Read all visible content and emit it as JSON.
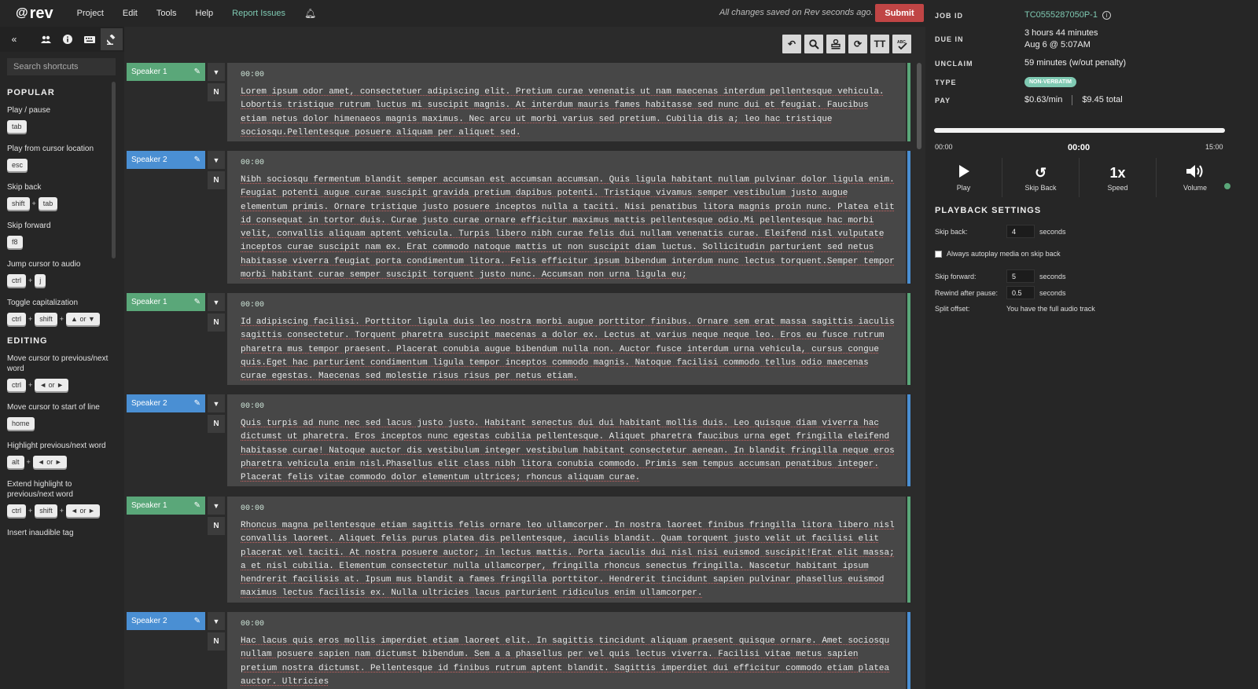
{
  "app": {
    "logo": "rev",
    "menu": [
      "Project",
      "Edit",
      "Tools",
      "Help",
      "Report Issues"
    ],
    "saved_status": "All changes saved on Rev seconds ago.",
    "submit_label": "Submit"
  },
  "sidebar": {
    "tabs": [
      "collapse-icon",
      "people-icon",
      "info-icon",
      "keyboard-icon",
      "gavel-icon"
    ],
    "search_placeholder": "Search shortcuts",
    "sections": [
      {
        "title": "POPULAR",
        "items": [
          {
            "label": "Play / pause",
            "keys": [
              "tab"
            ]
          },
          {
            "label": "Play from cursor location",
            "keys": [
              "esc"
            ]
          },
          {
            "label": "Skip back",
            "keys": [
              "shift",
              "tab"
            ]
          },
          {
            "label": "Skip forward",
            "keys": [
              "f8"
            ]
          },
          {
            "label": "Jump cursor to audio",
            "keys": [
              "ctrl",
              "j"
            ]
          },
          {
            "label": "Toggle capitalization",
            "keys": [
              "ctrl",
              "shift",
              "▲ or ▼"
            ]
          }
        ]
      },
      {
        "title": "EDITING",
        "items": [
          {
            "label": "Move cursor to previous/next word",
            "keys": [
              "ctrl",
              "◄ or ►"
            ]
          },
          {
            "label": "Move cursor to start of line",
            "keys": [
              "home"
            ]
          },
          {
            "label": "Highlight previous/next word",
            "keys": [
              "alt",
              "◄ or ►"
            ]
          },
          {
            "label": "Extend highlight to previous/next word",
            "keys": [
              "ctrl",
              "shift",
              "◄ or ►"
            ]
          },
          {
            "label": "Insert inaudible tag",
            "keys": []
          }
        ]
      }
    ]
  },
  "toolbar": {
    "tools": [
      "undo-icon",
      "search-icon",
      "stamp-icon",
      "rotate-icon",
      "text-size-icon",
      "spellcheck-icon"
    ]
  },
  "segments": [
    {
      "speaker": "Speaker 1",
      "color_class": "s1",
      "timestamp": "00:00",
      "text": "Lorem ipsum odor amet, consectetuer adipiscing elit. Pretium curae venenatis ut nam maecenas interdum pellentesque vehicula. Lobortis tristique rutrum luctus mi suscipit magnis. At interdum mauris fames habitasse sed nunc dui et feugiat. Faucibus etiam netus dolor himenaeos magnis maximus. Nec arcu ut morbi varius sed pretium. Cubilia dis a; leo hac tristique sociosqu.Pellentesque posuere aliquam per aliquet sed."
    },
    {
      "speaker": "Speaker 2",
      "color_class": "s2",
      "timestamp": "00:00",
      "text": "Nibh sociosqu fermentum blandit semper accumsan est accumsan accumsan. Quis ligula habitant nullam pulvinar dolor ligula enim. Feugiat potenti augue curae suscipit gravida pretium dapibus potenti. Tristique vivamus semper vestibulum justo augue elementum primis. Ornare tristique justo posuere inceptos nulla a taciti. Nisi penatibus litora magnis proin nunc. Platea elit id consequat in tortor duis. Curae justo curae ornare efficitur maximus mattis pellentesque odio.Mi pellentesque hac morbi velit, convallis aliquam aptent vehicula. Turpis libero nibh curae felis dui nullam venenatis curae. Eleifend nisl vulputate inceptos curae suscipit nam ex. Erat commodo natoque mattis ut non suscipit diam luctus. Sollicitudin parturient sed netus habitasse viverra feugiat porta condimentum litora. Felis efficitur ipsum bibendum interdum nunc lectus torquent.Semper tempor morbi habitant curae semper suscipit torquent justo nunc. Accumsan non urna ligula eu;"
    },
    {
      "speaker": "Speaker 1",
      "color_class": "s1",
      "timestamp": "00:00",
      "text": "Id adipiscing facilisi. Porttitor ligula duis leo nostra morbi augue porttitor finibus. Ornare sem erat massa sagittis iaculis sagittis consectetur. Torquent pharetra suscipit maecenas a dolor ex. Lectus at varius neque neque leo. Eros eu fusce rutrum pharetra mus tempor praesent. Placerat conubia augue bibendum nulla non. Auctor fusce interdum urna vehicula, cursus congue quis.Eget hac parturient condimentum ligula tempor inceptos commodo magnis. Natoque facilisi commodo tellus odio maecenas curae egestas. Maecenas sed molestie risus risus per netus etiam."
    },
    {
      "speaker": "Speaker 2",
      "color_class": "s2",
      "timestamp": "00:00",
      "text": "Quis turpis ad nunc nec sed lacus justo justo. Habitant senectus dui dui habitant mollis duis. Leo quisque diam viverra hac dictumst ut pharetra. Eros inceptos nunc egestas cubilia pellentesque. Aliquet pharetra faucibus urna eget fringilla eleifend habitasse curae! Natoque auctor dis vestibulum integer vestibulum habitant consectetur aenean. In blandit fringilla neque eros pharetra vehicula enim nisl.Phasellus elit class nibh litora conubia commodo. Primis sem tempus accumsan penatibus integer. Placerat felis vitae commodo dolor elementum ultrices; rhoncus aliquam curae."
    },
    {
      "speaker": "Speaker 1",
      "color_class": "s1",
      "timestamp": "00:00",
      "text": "Rhoncus magna pellentesque etiam sagittis felis ornare leo ullamcorper. In nostra laoreet finibus fringilla litora libero nisl convallis laoreet. Aliquet felis purus platea dis pellentesque, iaculis blandit. Quam torquent justo velit ut facilisi elit placerat vel taciti. At nostra posuere auctor; in lectus mattis. Porta iaculis dui nisl nisi euismod suscipit!Erat elit massa; a et nisl cubilia. Elementum consectetur nulla ullamcorper, fringilla rhoncus senectus fringilla. Nascetur habitant ipsum hendrerit facilisis at. Ipsum mus blandit a fames fringilla porttitor. Hendrerit tincidunt sapien pulvinar phasellus euismod maximus lectus facilisis ex. Nulla ultricies lacus parturient ridiculus enim ullamcorper."
    },
    {
      "speaker": "Speaker 2",
      "color_class": "s2",
      "timestamp": "00:00",
      "text": "Hac lacus quis eros mollis imperdiet etiam laoreet elit. In sagittis tincidunt aliquam praesent quisque ornare. Amet sociosqu nullam posuere sapien nam dictumst bibendum. Sem a a phasellus per vel quis lectus viverra. Facilisi vitae metus sapien pretium nostra dictumst. Pellentesque id finibus rutrum aptent blandit. Sagittis imperdiet dui efficitur commodo etiam platea auctor. Ultricies"
    }
  ],
  "job": {
    "job_id_label": "JOB ID",
    "job_id": "TC0555287050P-1",
    "due_label": "DUE IN",
    "due_line1": "3 hours 44 minutes",
    "due_line2": "Aug 6 @ 5:07AM",
    "unclaim_label": "UNCLAIM",
    "unclaim_value": "59 minutes (w/out penalty)",
    "type_label": "TYPE",
    "type_value": "NON-VERBATIM",
    "pay_label": "PAY",
    "pay_rate": "$0.63/min",
    "pay_total": "$9.45 total"
  },
  "player": {
    "start_time": "00:00",
    "current_time": "00:00",
    "end_time": "15:00",
    "progress": 0,
    "play_label": "Play",
    "skipback_label": "Skip Back",
    "speed_value": "1x",
    "speed_label": "Speed",
    "volume_label": "Volume"
  },
  "playback_settings": {
    "title": "PLAYBACK SETTINGS",
    "skip_back_label": "Skip back:",
    "skip_back_value": "4",
    "seconds": "seconds",
    "autoplay_label": "Always autoplay media on skip back",
    "skip_forward_label": "Skip forward:",
    "skip_forward_value": "5",
    "rewind_label": "Rewind after pause:",
    "rewind_value": "0.5",
    "split_label": "Split offset:",
    "split_value": "You have the full audio track"
  },
  "colors": {
    "speaker1": "#5aa779",
    "speaker2": "#4a8fd3",
    "submit": "#c04545",
    "accent": "#7fc9b2"
  }
}
